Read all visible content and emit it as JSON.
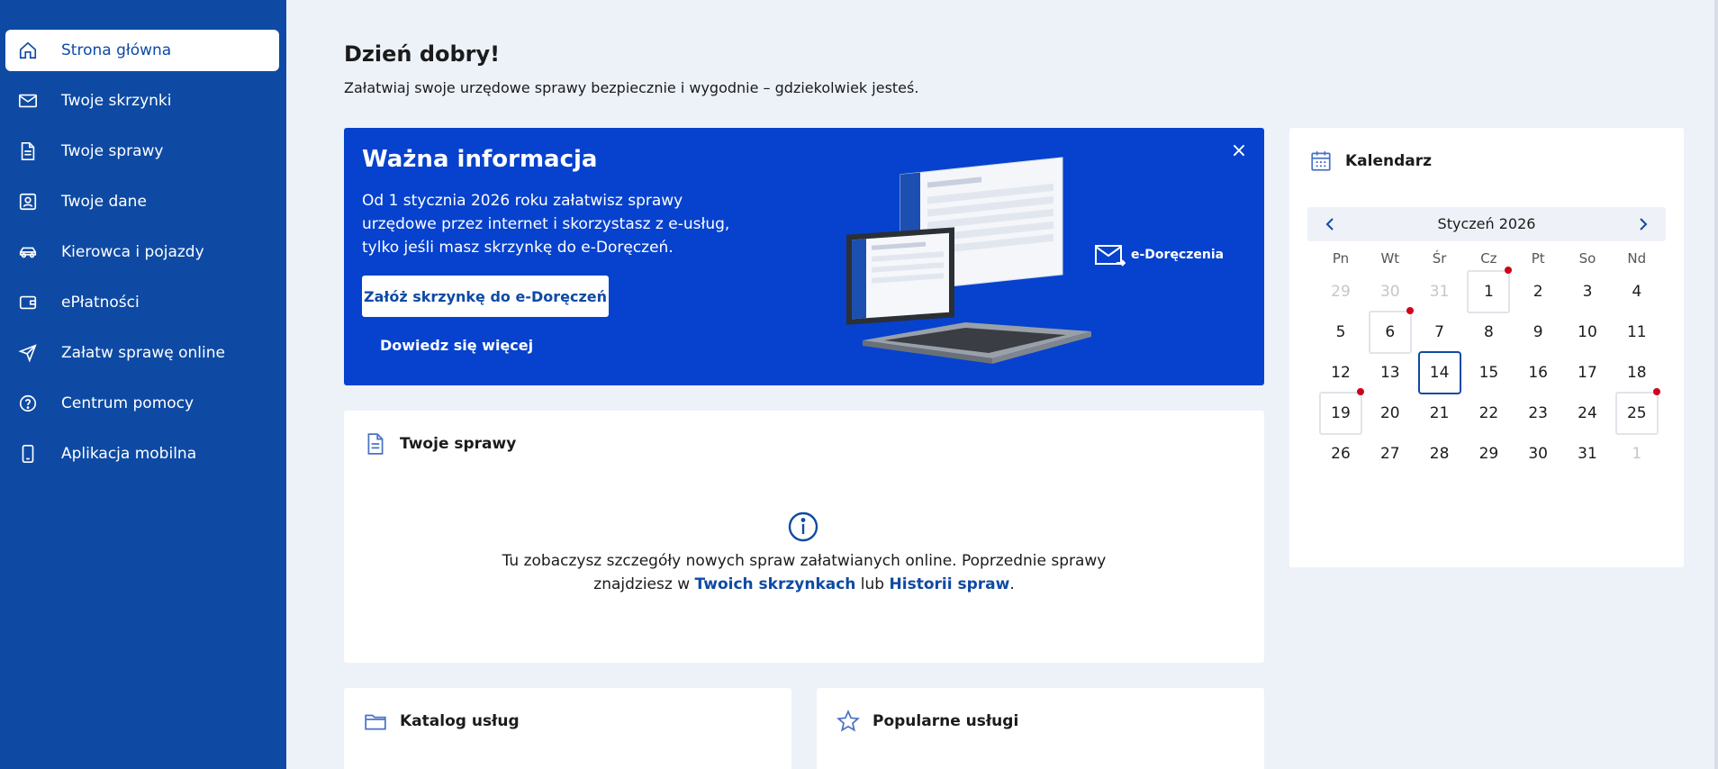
{
  "sidebar": {
    "items": [
      {
        "label": "Strona główna",
        "icon": "home-icon",
        "active": true
      },
      {
        "label": "Twoje skrzynki",
        "icon": "mail-icon"
      },
      {
        "label": "Twoje sprawy",
        "icon": "document-icon"
      },
      {
        "label": "Twoje dane",
        "icon": "user-card-icon"
      },
      {
        "label": "Kierowca i pojazdy",
        "icon": "car-icon"
      },
      {
        "label": "ePłatności",
        "icon": "wallet-icon"
      },
      {
        "label": "Załatw sprawę online",
        "icon": "send-icon"
      },
      {
        "label": "Centrum pomocy",
        "icon": "help-icon"
      },
      {
        "label": "Aplikacja mobilna",
        "icon": "phone-icon"
      }
    ]
  },
  "greeting": {
    "title": "Dzień dobry!",
    "subtitle": "Załatwiaj swoje urzędowe sprawy bezpiecznie i wygodnie – gdziekolwiek jesteś."
  },
  "banner": {
    "title": "Ważna informacja",
    "text": "Od 1 stycznia 2026 roku załatwisz sprawy urzędowe przez internet i skorzystasz z e-usług, tylko jeśli masz skrzynkę do e-Doręczeń.",
    "primary_button": "Załóż skrzynkę do e-Doręczeń",
    "link": "Dowiedz się więcej",
    "brand": "e-Doręczenia",
    "close": "×"
  },
  "cases": {
    "title": "Twoje sprawy",
    "text_line1": "Tu zobaczysz szczegóły nowych spraw załatwianych online. Poprzednie sprawy",
    "text_line2_pre": "znajdziesz w ",
    "link1": "Twoich skrzynkach",
    "text_mid": " lub ",
    "link2": "Historii spraw",
    "text_end": "."
  },
  "catalog": {
    "title": "Katalog usług"
  },
  "popular": {
    "title": "Popularne usługi"
  },
  "calendar": {
    "title": "Kalendarz",
    "month": "Styczeń 2026",
    "weekdays": [
      "Pn",
      "Wt",
      "Śr",
      "Cz",
      "Pt",
      "So",
      "Nd"
    ],
    "weeks": [
      [
        {
          "d": "29",
          "m": true
        },
        {
          "d": "30",
          "m": true
        },
        {
          "d": "31",
          "m": true
        },
        {
          "d": "1",
          "box": true,
          "dot": true
        },
        {
          "d": "2"
        },
        {
          "d": "3"
        },
        {
          "d": "4"
        }
      ],
      [
        {
          "d": "5"
        },
        {
          "d": "6",
          "box": true,
          "dot": true
        },
        {
          "d": "7"
        },
        {
          "d": "8"
        },
        {
          "d": "9"
        },
        {
          "d": "10"
        },
        {
          "d": "11"
        }
      ],
      [
        {
          "d": "12"
        },
        {
          "d": "13"
        },
        {
          "d": "14",
          "today": true
        },
        {
          "d": "15"
        },
        {
          "d": "16"
        },
        {
          "d": "17"
        },
        {
          "d": "18"
        }
      ],
      [
        {
          "d": "19",
          "box": true,
          "dot": true
        },
        {
          "d": "20"
        },
        {
          "d": "21"
        },
        {
          "d": "22"
        },
        {
          "d": "23"
        },
        {
          "d": "24"
        },
        {
          "d": "25",
          "box": true,
          "dot": true
        }
      ],
      [
        {
          "d": "26"
        },
        {
          "d": "27"
        },
        {
          "d": "28"
        },
        {
          "d": "29"
        },
        {
          "d": "30"
        },
        {
          "d": "31"
        },
        {
          "d": "1",
          "m": true
        }
      ]
    ],
    "event_dot_color": "#d0021b",
    "accent_color": "#0e4aa4"
  }
}
